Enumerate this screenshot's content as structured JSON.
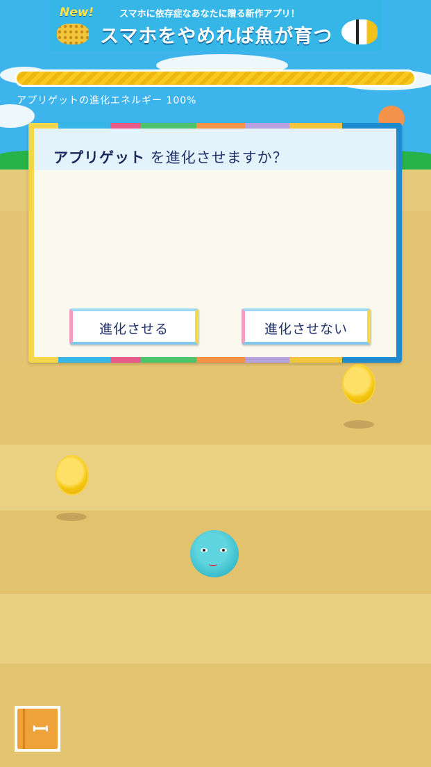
{
  "ad_banner": {
    "badge": "New!",
    "subtitle": "スマホに依存症なあなたに贈る新作アプリ！",
    "title": "スマホをやめれば魚が育つ"
  },
  "energy": {
    "label": "アプリゲットの進化エネルギー 100%",
    "value_percent": 100
  },
  "dialog": {
    "name": "アプリゲット",
    "question": " を進化させますか？",
    "confirm_label": "進化させる",
    "cancel_label": "進化させない"
  },
  "icons": [
    "coin-icon",
    "creature-character",
    "book-icon"
  ],
  "colors": {
    "sky": "#3db4ec",
    "grass": "#27b34a",
    "sand": "#e2c472",
    "energy_bar": "#f8c91f",
    "dialog_text": "#22336b"
  }
}
